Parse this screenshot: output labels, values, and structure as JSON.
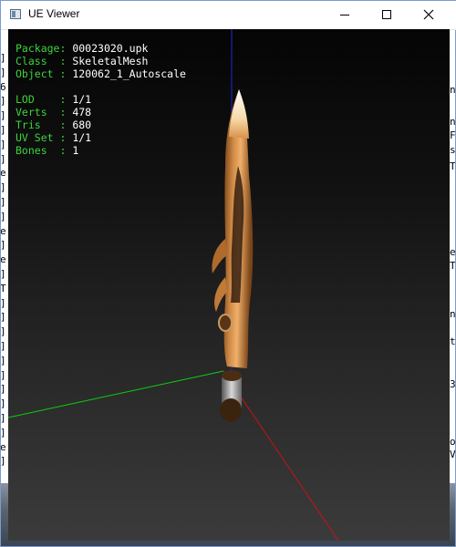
{
  "window": {
    "title": "UE Viewer"
  },
  "colors": {
    "label_green": "#3cd43c",
    "value_white": "#ffffff",
    "axis_x": "#cc1111",
    "axis_y": "#11cc11",
    "axis_z": "#1a2ad8"
  },
  "info": {
    "package_label": "Package:",
    "package_value": "00023020.upk",
    "class_label": "Class  :",
    "class_value": "SkeletalMesh",
    "object_label": "Object :",
    "object_value": "120062_1_Autoscale",
    "lod_label": "LOD    :",
    "lod_value": "1/1",
    "verts_label": "Verts  :",
    "verts_value": "478",
    "tris_label": "Tris   :",
    "tris_value": "680",
    "uvset_label": "UV Set :",
    "uvset_value": "1/1",
    "bones_label": "Bones  :",
    "bones_value": "1"
  },
  "background_console": {
    "left_glyphs": [
      "]",
      "]",
      "6",
      "]",
      "]",
      "]",
      "]",
      "]",
      "e",
      "]",
      "]",
      "]",
      "e",
      "]",
      "e",
      "]",
      "T",
      "]",
      "]",
      "]",
      "]",
      "]",
      "]",
      "]",
      "]",
      "]",
      "]",
      "e",
      "]"
    ],
    "right_glyphs": [
      "n",
      "n",
      "F",
      "s",
      "T",
      "e",
      "T",
      "n",
      "t",
      "3",
      "o",
      "V"
    ]
  }
}
